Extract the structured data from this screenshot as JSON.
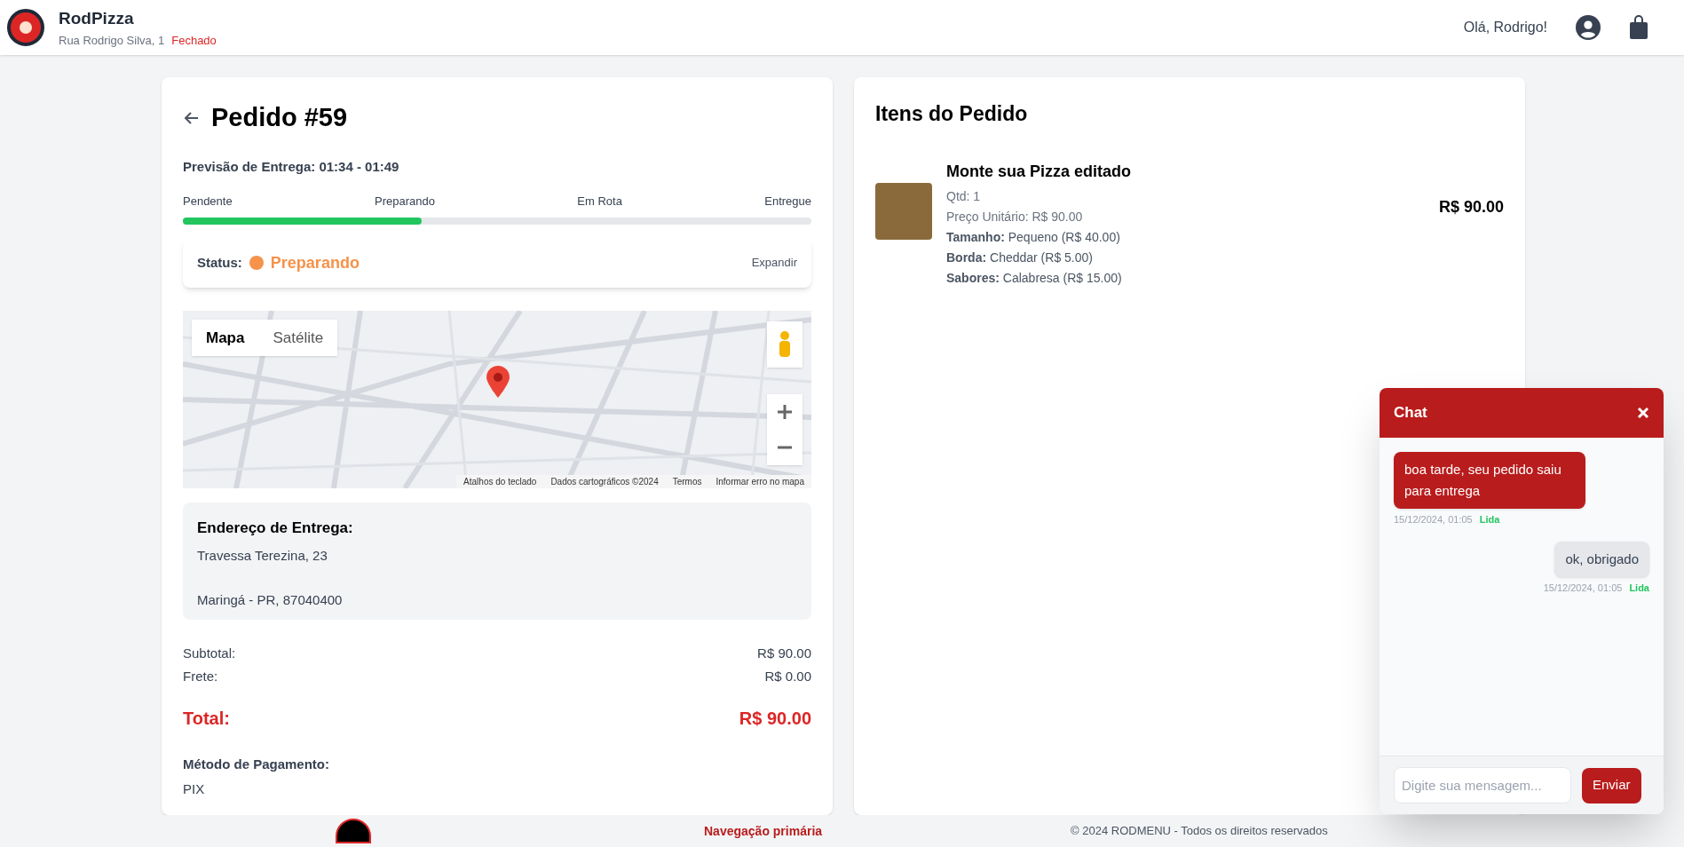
{
  "header": {
    "store_name": "RodPizza",
    "address": "Rua Rodrigo Silva, 1",
    "store_status": "Fechado",
    "greeting": "Olá, Rodrigo!"
  },
  "order": {
    "title": "Pedido #59",
    "delivery_estimate": "Previsão de Entrega: 01:34 - 01:49",
    "steps": [
      {
        "label": "Pendente"
      },
      {
        "label": "Preparando"
      },
      {
        "label": "Em Rota"
      },
      {
        "label": "Entregue"
      }
    ],
    "progress": {
      "level": 0.38
    },
    "status": {
      "label": "Status:",
      "value": "Preparando",
      "color": "#f6924a",
      "action": "Expandir"
    },
    "map": {
      "map_types": [
        {
          "label": "Mapa",
          "selected": true
        },
        {
          "label": "Satélite",
          "selected": false
        }
      ],
      "attribution": [
        "Atalhos do teclado",
        "Dados cartográficos ©2024",
        "Termos",
        "Informar erro no mapa"
      ]
    },
    "address": {
      "title": "Endereço de Entrega:",
      "line_1": "Travessa Terezina, 23",
      "line_2": "Maringá - PR, 87040400"
    },
    "subtotal": {
      "label": "Subtotal:",
      "value": "R$ 90.00"
    },
    "shipping": {
      "label": "Frete:",
      "value": "R$ 0.00"
    },
    "total": {
      "label": "Total:",
      "value": "R$ 90.00"
    },
    "payment": {
      "label": "Método de Pagamento:",
      "value": "PIX"
    }
  },
  "items": {
    "title": "Itens do Pedido",
    "list": [
      {
        "name": "Monte sua Pizza editado",
        "quantity": "Qtd: 1",
        "unit_price": "Preço Unitário: R$ 90.00",
        "options": [
          {
            "label": "Tamanho:",
            "value": "Pequeno (R$ 40.00)"
          },
          {
            "label": "Borda:",
            "value": "Cheddar (R$ 5.00)"
          },
          {
            "label": "Sabores:",
            "value": "Calabresa (R$ 15.00)"
          }
        ],
        "total": "R$ 90.00"
      }
    ]
  },
  "chat": {
    "title": "Chat",
    "messages": [
      {
        "kind": "received",
        "text": "boa tarde, seu pedido saiu para entrega",
        "time": "15/12/2024, 01:05",
        "receipt": "Lida"
      },
      {
        "kind": "sent",
        "text": "ok, obrigado",
        "time": "15/12/2024, 01:05",
        "receipt": "Lida"
      }
    ],
    "input": {
      "placeholder": "Digite sua mensagem..."
    },
    "send": "Enviar"
  },
  "footer": {
    "nav_title": "Navegação primária",
    "copyright": "© 2024 RODMENU - Todos os direitos reservados"
  }
}
